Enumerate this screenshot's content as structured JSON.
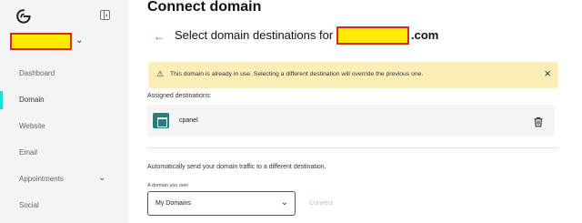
{
  "sidebar": {
    "site_name": "",
    "items": [
      {
        "label": "Dashboard"
      },
      {
        "label": "Domain"
      },
      {
        "label": "Website"
      },
      {
        "label": "Email"
      },
      {
        "label": "Appointments"
      },
      {
        "label": "Social"
      }
    ],
    "active_item": "Domain"
  },
  "header": {
    "title": "Connect domain",
    "subtitle_prefix": "Select domain destinations for",
    "domain_name": "",
    "domain_tld": ".com"
  },
  "alert": {
    "message": "This domain is already in use. Selecting a different destination will override the previous one."
  },
  "assigned": {
    "label": "Assigned destinations:",
    "destinations": [
      {
        "name": "cpanel"
      }
    ]
  },
  "redirect": {
    "description": "Automatically send your domain traffic to a different destination.",
    "field_label": "A domain you own",
    "selected_value": "My Domains",
    "connect_label": "Connect"
  },
  "colors": {
    "accent": "#1bdbdb",
    "alert_bg": "#fbeeb7",
    "link": "#2f6fb8",
    "connect_disabled": "#a9c6e6",
    "destination_icon_bg": "#2f7a7a",
    "redaction_fill": "#ffea00",
    "redaction_border": "#d42b1e"
  }
}
